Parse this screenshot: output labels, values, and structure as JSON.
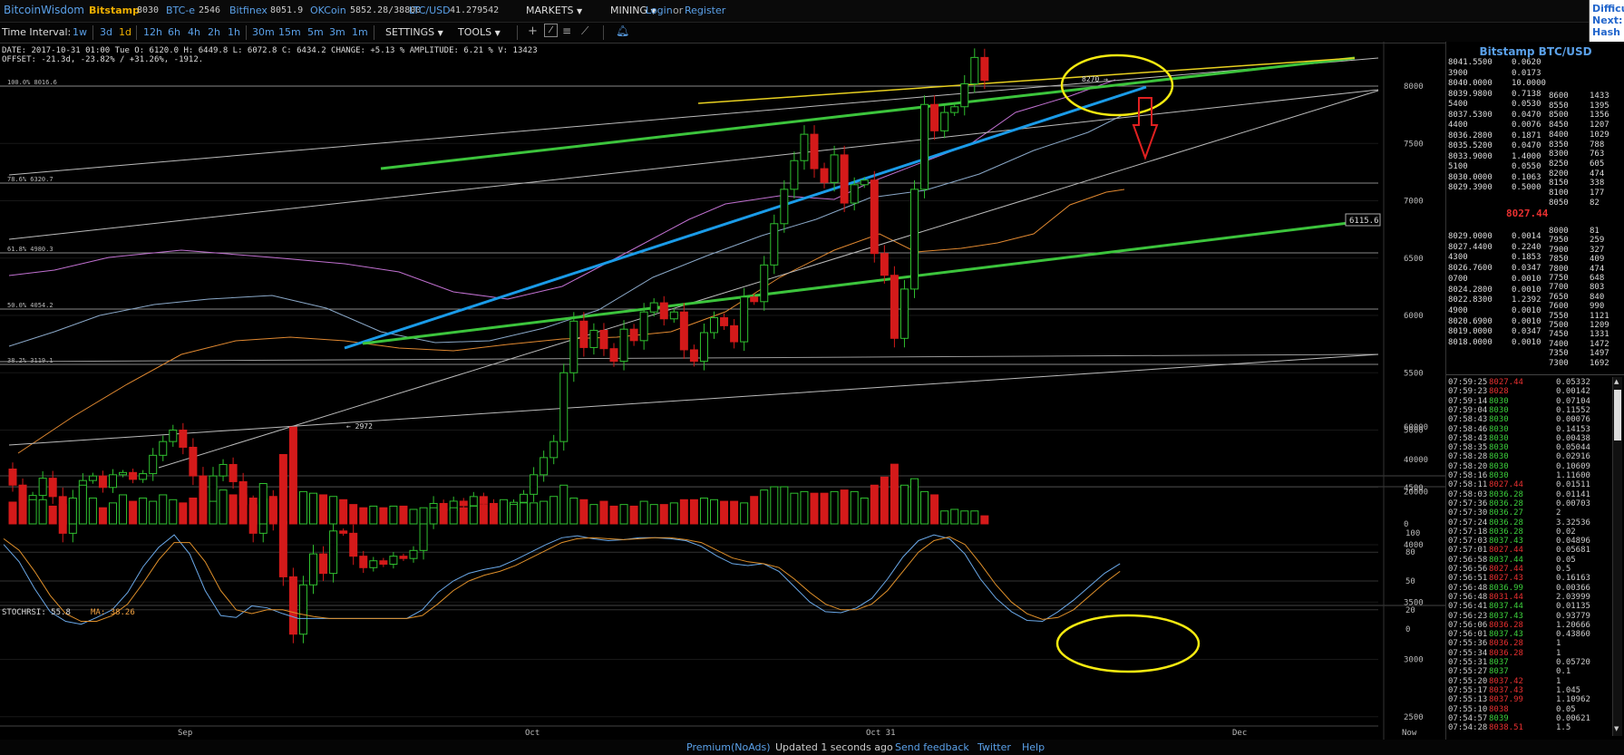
{
  "topbar": {
    "logo": "BitcoinWisdom",
    "tickers": [
      {
        "name": "Bitstamp",
        "price": "8030",
        "active": true
      },
      {
        "name": "BTC-e",
        "price": "2546"
      },
      {
        "name": "Bitfinex",
        "price": "8051.9"
      },
      {
        "name": "OKCoin",
        "price": "5852.28/38800"
      },
      {
        "name": "LTC/USD",
        "price": "41.279542"
      }
    ],
    "markets": "MARKETS",
    "mining": "MINING",
    "login": "Login",
    "or": "or",
    "register": "Register"
  },
  "diff": {
    "line1": "Difficulty",
    "line2": "Next:",
    "line3": "Hash Rate"
  },
  "controls": {
    "time_interval_label": "Time Interval:",
    "intervals": [
      "1w",
      "3d",
      "1d",
      "12h",
      "6h",
      "4h",
      "2h",
      "1h",
      "30m",
      "15m",
      "5m",
      "3m",
      "1m"
    ],
    "active_interval": "1d",
    "settings": "SETTINGS",
    "tools": "TOOLS"
  },
  "info": {
    "line1": "DATE: 2017-10-31 01:00 Tue   O: 6120.0   H: 6449.8   L: 6072.8   C: 6434.2  CHANGE: +5.13 %  AMPLITUDE: 6.21 %  V: 13423",
    "line2": "OFFSET: -21.3d, -23.82% / +31.26%, -1912."
  },
  "chart_data": {
    "type": "candlestick",
    "price_axis": [
      8500,
      8000,
      7500,
      7000,
      6500,
      6000,
      5500,
      5000,
      4500,
      4000,
      3500,
      3000,
      2500
    ],
    "volume_axis": [
      60000,
      40000,
      20000,
      0
    ],
    "stoch_axis": [
      100,
      80,
      50,
      20,
      0
    ],
    "x_labels": [
      "Sep",
      "Oct",
      "Oct 31",
      "Dec",
      "Now"
    ],
    "fib_levels": [
      "100.0% 8016.6",
      "78.6% 6320.7",
      "61.8% 4980.3",
      "50.0% 4054.2",
      "38.2% 3119.1"
    ],
    "cursor_price": "6115.6",
    "annotations": [
      "8270",
      "2972"
    ],
    "candles": [
      [
        4660,
        4520
      ],
      [
        4520,
        4380
      ],
      [
        4380,
        4430
      ],
      [
        4430,
        4580
      ],
      [
        4580,
        4420
      ],
      [
        4420,
        4100
      ],
      [
        4100,
        4400
      ],
      [
        4400,
        4560
      ],
      [
        4560,
        4600
      ],
      [
        4600,
        4500
      ],
      [
        4500,
        4610
      ],
      [
        4610,
        4630
      ],
      [
        4630,
        4570
      ],
      [
        4570,
        4620
      ],
      [
        4620,
        4780
      ],
      [
        4780,
        4900
      ],
      [
        4900,
        5000
      ],
      [
        5000,
        4850
      ],
      [
        4850,
        4600
      ],
      [
        4600,
        4280
      ],
      [
        4280,
        4600
      ],
      [
        4600,
        4700
      ],
      [
        4700,
        4550
      ],
      [
        4550,
        4350
      ],
      [
        4350,
        4100
      ],
      [
        4100,
        4400
      ],
      [
        4400,
        4200
      ],
      [
        4200,
        3720
      ],
      [
        3720,
        3220
      ],
      [
        3220,
        3650
      ],
      [
        3650,
        3920
      ],
      [
        3920,
        3750
      ],
      [
        3750,
        4120
      ],
      [
        4120,
        4100
      ],
      [
        4100,
        3900
      ],
      [
        3900,
        3800
      ],
      [
        3800,
        3860
      ],
      [
        3860,
        3830
      ],
      [
        3830,
        3900
      ],
      [
        3900,
        3880
      ],
      [
        3880,
        3950
      ],
      [
        3950,
        4200
      ],
      [
        4200,
        4360
      ],
      [
        4360,
        4300
      ],
      [
        4300,
        4380
      ],
      [
        4380,
        4340
      ],
      [
        4340,
        4420
      ],
      [
        4420,
        4360
      ],
      [
        4360,
        4290
      ],
      [
        4290,
        4340
      ],
      [
        4340,
        4370
      ],
      [
        4370,
        4440
      ],
      [
        4440,
        4610
      ],
      [
        4610,
        4760
      ],
      [
        4760,
        4900
      ],
      [
        4900,
        5500
      ],
      [
        5500,
        5950
      ],
      [
        5950,
        5720
      ],
      [
        5720,
        5870
      ],
      [
        5870,
        5710
      ],
      [
        5710,
        5600
      ],
      [
        5600,
        5880
      ],
      [
        5880,
        5780
      ],
      [
        5780,
        6030
      ],
      [
        6030,
        6110
      ],
      [
        6110,
        5970
      ],
      [
        5970,
        6030
      ],
      [
        6030,
        5700
      ],
      [
        5700,
        5600
      ],
      [
        5600,
        5850
      ],
      [
        5850,
        5980
      ],
      [
        5980,
        5910
      ],
      [
        5910,
        5770
      ],
      [
        5770,
        6160
      ],
      [
        6160,
        6120
      ],
      [
        6120,
        6440
      ],
      [
        6440,
        6800
      ],
      [
        6800,
        7100
      ],
      [
        7100,
        7350
      ],
      [
        7350,
        7580
      ],
      [
        7580,
        7280
      ],
      [
        7280,
        7160
      ],
      [
        7160,
        7400
      ],
      [
        7400,
        6980
      ],
      [
        6980,
        7140
      ],
      [
        7140,
        7180
      ],
      [
        7180,
        6540
      ],
      [
        6540,
        6350
      ],
      [
        6350,
        5800
      ],
      [
        5800,
        6230
      ],
      [
        6230,
        7100
      ],
      [
        7100,
        7840
      ],
      [
        7840,
        7610
      ],
      [
        7610,
        7770
      ],
      [
        7770,
        7820
      ],
      [
        7820,
        8020
      ],
      [
        8020,
        8250
      ],
      [
        8250,
        8050
      ]
    ],
    "volumes": [
      13500,
      17000,
      15000,
      15000,
      11000,
      12000,
      16000,
      24000,
      16000,
      10000,
      13000,
      18000,
      14000,
      16000,
      14000,
      18000,
      15000,
      13000,
      16000,
      19000,
      14000,
      21000,
      18000,
      18000,
      16000,
      25000,
      17000,
      43000,
      60000,
      20000,
      19000,
      18000,
      17000,
      15000,
      12000,
      10000,
      11000,
      10000,
      11000,
      11000,
      9000,
      10000,
      10000,
      9000,
      10000,
      10000,
      11000,
      12000,
      10000,
      15000,
      12000,
      13000,
      13000,
      14000,
      17000,
      24000,
      16000,
      15000,
      12000,
      14000,
      11000,
      12000,
      11000,
      14000,
      12000,
      12000,
      13000,
      15000,
      15000,
      16000,
      15000,
      14000,
      14000,
      13000,
      17000,
      21000,
      23000,
      23000,
      19000,
      20000,
      19000,
      19000,
      20000,
      21000,
      20000,
      16000,
      24000,
      29000,
      37000,
      24000,
      28000,
      20000,
      18000,
      8000,
      9000,
      8000,
      8000,
      5000
    ],
    "stoch_k": [
      88,
      70,
      42,
      18,
      8,
      5,
      12,
      20,
      38,
      65,
      85,
      98,
      78,
      40,
      14,
      12,
      24,
      22,
      16,
      11,
      11,
      11,
      11,
      11,
      11,
      11,
      11,
      20,
      38,
      50,
      58,
      62,
      65,
      72,
      80,
      88,
      95,
      97,
      94,
      92,
      93,
      95,
      95,
      94,
      92,
      86,
      76,
      68,
      66,
      68,
      60,
      44,
      28,
      18,
      17,
      22,
      32,
      52,
      75,
      92,
      98,
      94,
      78,
      52,
      32,
      18,
      9,
      8,
      18,
      30,
      44,
      58,
      68
    ],
    "stoch_ma": [
      94,
      82,
      60,
      35,
      16,
      8,
      8,
      14,
      26,
      48,
      72,
      90,
      90,
      70,
      40,
      20,
      16,
      20,
      20,
      16,
      13,
      11,
      11,
      11,
      11,
      11,
      11,
      14,
      26,
      40,
      50,
      56,
      60,
      66,
      74,
      82,
      90,
      94,
      95,
      94,
      93,
      94,
      95,
      95,
      93,
      90,
      82,
      74,
      70,
      68,
      64,
      52,
      38,
      26,
      20,
      20,
      26,
      40,
      60,
      80,
      92,
      96,
      88,
      68,
      46,
      28,
      16,
      10,
      12,
      20,
      34,
      48,
      60
    ]
  },
  "orderbook": {
    "title": "Bitstamp BTC/USD",
    "last_price": "8027.44",
    "asks": [
      [
        "8041.5500",
        "0.0620"
      ],
      [
        "3900",
        "0.0173"
      ],
      [
        "8040.0000",
        "10.0000"
      ],
      [
        "8039.9800",
        "0.7138"
      ],
      [
        "5400",
        "0.0530"
      ],
      [
        "8037.5300",
        "0.0470"
      ],
      [
        "4400",
        "0.0076"
      ],
      [
        "8036.2800",
        "0.1871"
      ],
      [
        "8035.5200",
        "0.0470"
      ],
      [
        "8033.9000",
        "1.4000"
      ],
      [
        "5100",
        "0.0550"
      ],
      [
        "8030.0000",
        "0.1063"
      ],
      [
        "8029.3900",
        "0.5000"
      ]
    ],
    "bids": [
      [
        "8029.0000",
        "0.0014"
      ],
      [
        "8027.4400",
        "0.2240"
      ],
      [
        "4300",
        "0.1853"
      ],
      [
        "8026.7600",
        "0.0347"
      ],
      [
        "0700",
        "0.0010"
      ],
      [
        "8024.2800",
        "0.0010"
      ],
      [
        "8022.8300",
        "1.2392"
      ],
      [
        "4900",
        "0.0010"
      ],
      [
        "8020.6900",
        "0.0010"
      ],
      [
        "8019.0000",
        "0.0347"
      ],
      [
        "8018.0000",
        "0.0010"
      ]
    ],
    "depth_asks": [
      [
        "8600",
        "1433"
      ],
      [
        "8550",
        "1395"
      ],
      [
        "8500",
        "1356"
      ],
      [
        "8450",
        "1207"
      ],
      [
        "8400",
        "1029"
      ],
      [
        "8350",
        "788"
      ],
      [
        "8300",
        "763"
      ],
      [
        "8250",
        "605"
      ],
      [
        "8200",
        "474"
      ],
      [
        "8150",
        "338"
      ],
      [
        "8100",
        "177"
      ],
      [
        "8050",
        "82"
      ]
    ],
    "depth_bids": [
      [
        "8000",
        "81"
      ],
      [
        "7950",
        "259"
      ],
      [
        "7900",
        "327"
      ],
      [
        "7850",
        "409"
      ],
      [
        "7800",
        "474"
      ],
      [
        "7750",
        "648"
      ],
      [
        "7700",
        "803"
      ],
      [
        "7650",
        "840"
      ],
      [
        "7600",
        "990"
      ],
      [
        "7550",
        "1121"
      ],
      [
        "7500",
        "1209"
      ],
      [
        "7450",
        "1331"
      ],
      [
        "7400",
        "1472"
      ],
      [
        "7350",
        "1497"
      ],
      [
        "7300",
        "1692"
      ]
    ]
  },
  "trades": [
    [
      "07:59:25",
      "8027.44",
      "0.05332",
      "red"
    ],
    [
      "07:59:23",
      "8028",
      "0.00142",
      "red"
    ],
    [
      "07:59:14",
      "8030",
      "0.07104",
      "green"
    ],
    [
      "07:59:04",
      "8030",
      "0.11552",
      "green"
    ],
    [
      "07:58:43",
      "8030",
      "0.00076",
      "green"
    ],
    [
      "07:58:46",
      "8030",
      "0.14153",
      "green"
    ],
    [
      "07:58:43",
      "8030",
      "0.00438",
      "green"
    ],
    [
      "07:58:35",
      "8030",
      "0.05044",
      "green"
    ],
    [
      "07:58:28",
      "8030",
      "0.02916",
      "green"
    ],
    [
      "07:58:20",
      "8030",
      "0.10609",
      "green"
    ],
    [
      "07:58:16",
      "8030",
      "1.11600",
      "green"
    ],
    [
      "07:58:11",
      "8027.44",
      "0.01511",
      "red"
    ],
    [
      "07:58:03",
      "8036.28",
      "0.01141",
      "green"
    ],
    [
      "07:57:36",
      "8036.28",
      "0.00703",
      "green"
    ],
    [
      "07:57:30",
      "8036.27",
      "2",
      "green"
    ],
    [
      "07:57:24",
      "8036.28",
      "3.32536",
      "green"
    ],
    [
      "07:57:18",
      "8036.28",
      "0.02",
      "green"
    ],
    [
      "07:57:03",
      "8037.43",
      "0.04896",
      "green"
    ],
    [
      "07:57:01",
      "8027.44",
      "0.05681",
      "red"
    ],
    [
      "07:56:58",
      "8037.44",
      "0.05",
      "green"
    ],
    [
      "07:56:56",
      "8027.44",
      "0.5",
      "red"
    ],
    [
      "07:56:51",
      "8027.43",
      "0.16163",
      "red"
    ],
    [
      "07:56:48",
      "8036.99",
      "0.00366",
      "green"
    ],
    [
      "07:56:48",
      "8031.44",
      "2.03999",
      "red"
    ],
    [
      "07:56:41",
      "8037.44",
      "0.01135",
      "green"
    ],
    [
      "07:56:23",
      "8037.43",
      "0.93779",
      "green"
    ],
    [
      "07:56:06",
      "8036.28",
      "1.20666",
      "red"
    ],
    [
      "07:56:01",
      "8037.43",
      "0.43860",
      "green"
    ],
    [
      "07:55:36",
      "8036.28",
      "1",
      "red"
    ],
    [
      "07:55:34",
      "8036.28",
      "1",
      "red"
    ],
    [
      "07:55:31",
      "8037",
      "0.05720",
      "green"
    ],
    [
      "07:55:27",
      "8037",
      "0.1",
      "green"
    ],
    [
      "07:55:20",
      "8037.42",
      "1",
      "red"
    ],
    [
      "07:55:17",
      "8037.43",
      "1.045",
      "red"
    ],
    [
      "07:55:13",
      "8037.99",
      "1.10962",
      "red"
    ],
    [
      "07:55:10",
      "8038",
      "0.05",
      "red"
    ],
    [
      "07:54:57",
      "8039",
      "0.00621",
      "green"
    ],
    [
      "07:54:28",
      "8038.51",
      "1.5",
      "red"
    ]
  ],
  "footer": {
    "premium": "Premium(NoAds)",
    "updated": "Updated 1 seconds ago",
    "feedback": "Send feedback",
    "twitter": "Twitter",
    "help": "Help"
  },
  "colors": {
    "up": "#2fbf2f",
    "down": "#d41a1a",
    "link": "#5aa0e8",
    "active": "#f0b000",
    "trend_blue": "#1a9be8",
    "trend_green": "#3cc43c",
    "trend_yellow": "#e8d020",
    "ellipse": "#f5ea10"
  }
}
